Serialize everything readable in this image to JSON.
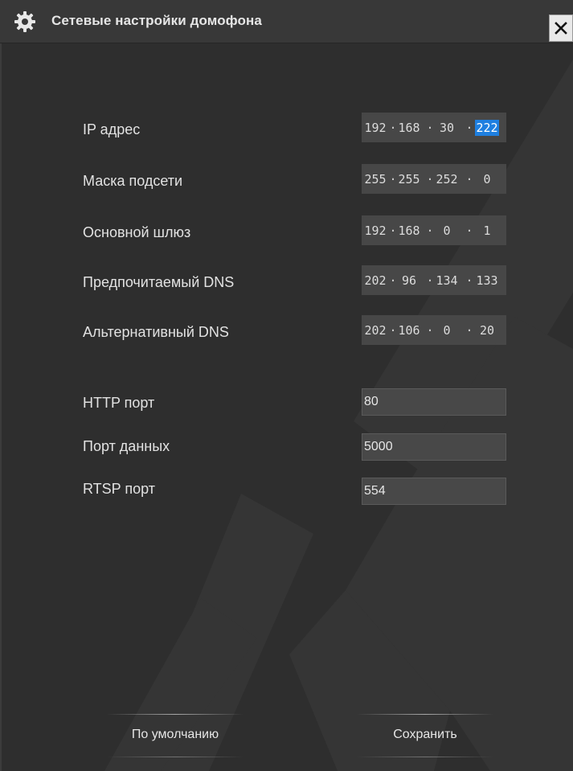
{
  "window": {
    "title": "Сетевые настройки домофона",
    "close_glyph": "×",
    "title_icon": "gear-icon",
    "close_icon": "close-icon"
  },
  "colors": {
    "background": "#2e2e2e",
    "titlebar": "#383838",
    "field": "#474747",
    "selection": "#1e7fe0",
    "text": "#e2e2e2"
  },
  "network": {
    "ip": {
      "label": "IP адрес",
      "octets": [
        "192",
        "168",
        "30",
        "222"
      ],
      "selected_octet": 3
    },
    "mask": {
      "label": "Маска подсети",
      "octets": [
        "255",
        "255",
        "252",
        "0"
      ]
    },
    "gateway": {
      "label": "Основной шлюз",
      "octets": [
        "192",
        "168",
        "0",
        "1"
      ]
    },
    "dns_primary": {
      "label": "Предпочитаемый DNS",
      "octets": [
        "202",
        "96",
        "134",
        "133"
      ]
    },
    "dns_alternate": {
      "label": "Альтернативный DNS",
      "octets": [
        "202",
        "106",
        "0",
        "20"
      ]
    }
  },
  "ports": {
    "http": {
      "label": "HTTP порт",
      "value": "80"
    },
    "data": {
      "label": "Порт данных",
      "value": "5000"
    },
    "rtsp": {
      "label": "RTSP порт",
      "value": "554"
    }
  },
  "buttons": {
    "default_label": "По умолчанию",
    "save_label": "Сохранить"
  }
}
